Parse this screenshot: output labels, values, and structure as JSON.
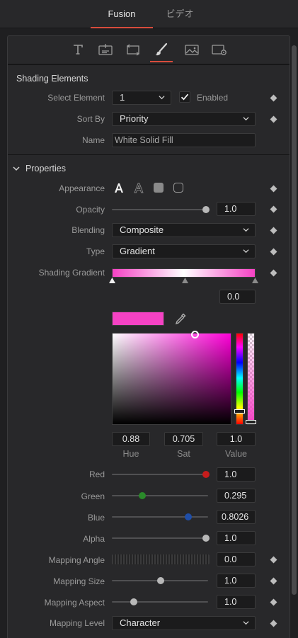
{
  "top_tabs": [
    {
      "label": "Fusion",
      "active": true
    },
    {
      "label": "ビデオ",
      "active": false
    }
  ],
  "toolbar_icons": [
    "text-icon",
    "layout-icon",
    "transform-icon",
    "shading-brush-icon",
    "image-icon",
    "settings-icon"
  ],
  "shading_elements": {
    "title": "Shading Elements",
    "select_element_label": "Select Element",
    "select_element_value": "1",
    "enabled_label": "Enabled",
    "enabled": true,
    "sort_by_label": "Sort By",
    "sort_by_value": "Priority",
    "name_label": "Name",
    "name_value": "White Solid Fill"
  },
  "properties": {
    "title": "Properties",
    "appearance_label": "Appearance",
    "opacity_label": "Opacity",
    "opacity_value": "1.0",
    "blending_label": "Blending",
    "blending_value": "Composite",
    "type_label": "Type",
    "type_value": "Gradient",
    "shading_gradient_label": "Shading Gradient",
    "gradient_position_value": "0.0",
    "swatch_color": "#f542c4",
    "hue_value": "0.88",
    "sat_value": "0.705",
    "val_value": "1.0",
    "hue_label": "Hue",
    "sat_label": "Sat",
    "val_label": "Value",
    "red_label": "Red",
    "red_value": "1.0",
    "green_label": "Green",
    "green_value": "0.295",
    "blue_label": "Blue",
    "blue_value": "0.8026",
    "alpha_label": "Alpha",
    "alpha_value": "1.0",
    "mapping_angle_label": "Mapping Angle",
    "mapping_angle_value": "0.0",
    "mapping_size_label": "Mapping Size",
    "mapping_size_value": "1.0",
    "mapping_aspect_label": "Mapping Aspect",
    "mapping_aspect_value": "1.0",
    "mapping_level_label": "Mapping Level",
    "mapping_level_value": "Character"
  },
  "colors": {
    "accent": "#d84c3c",
    "red_knob": "#c61c1c",
    "green_knob": "#2a8a2a",
    "blue_knob": "#1f4ea8"
  }
}
